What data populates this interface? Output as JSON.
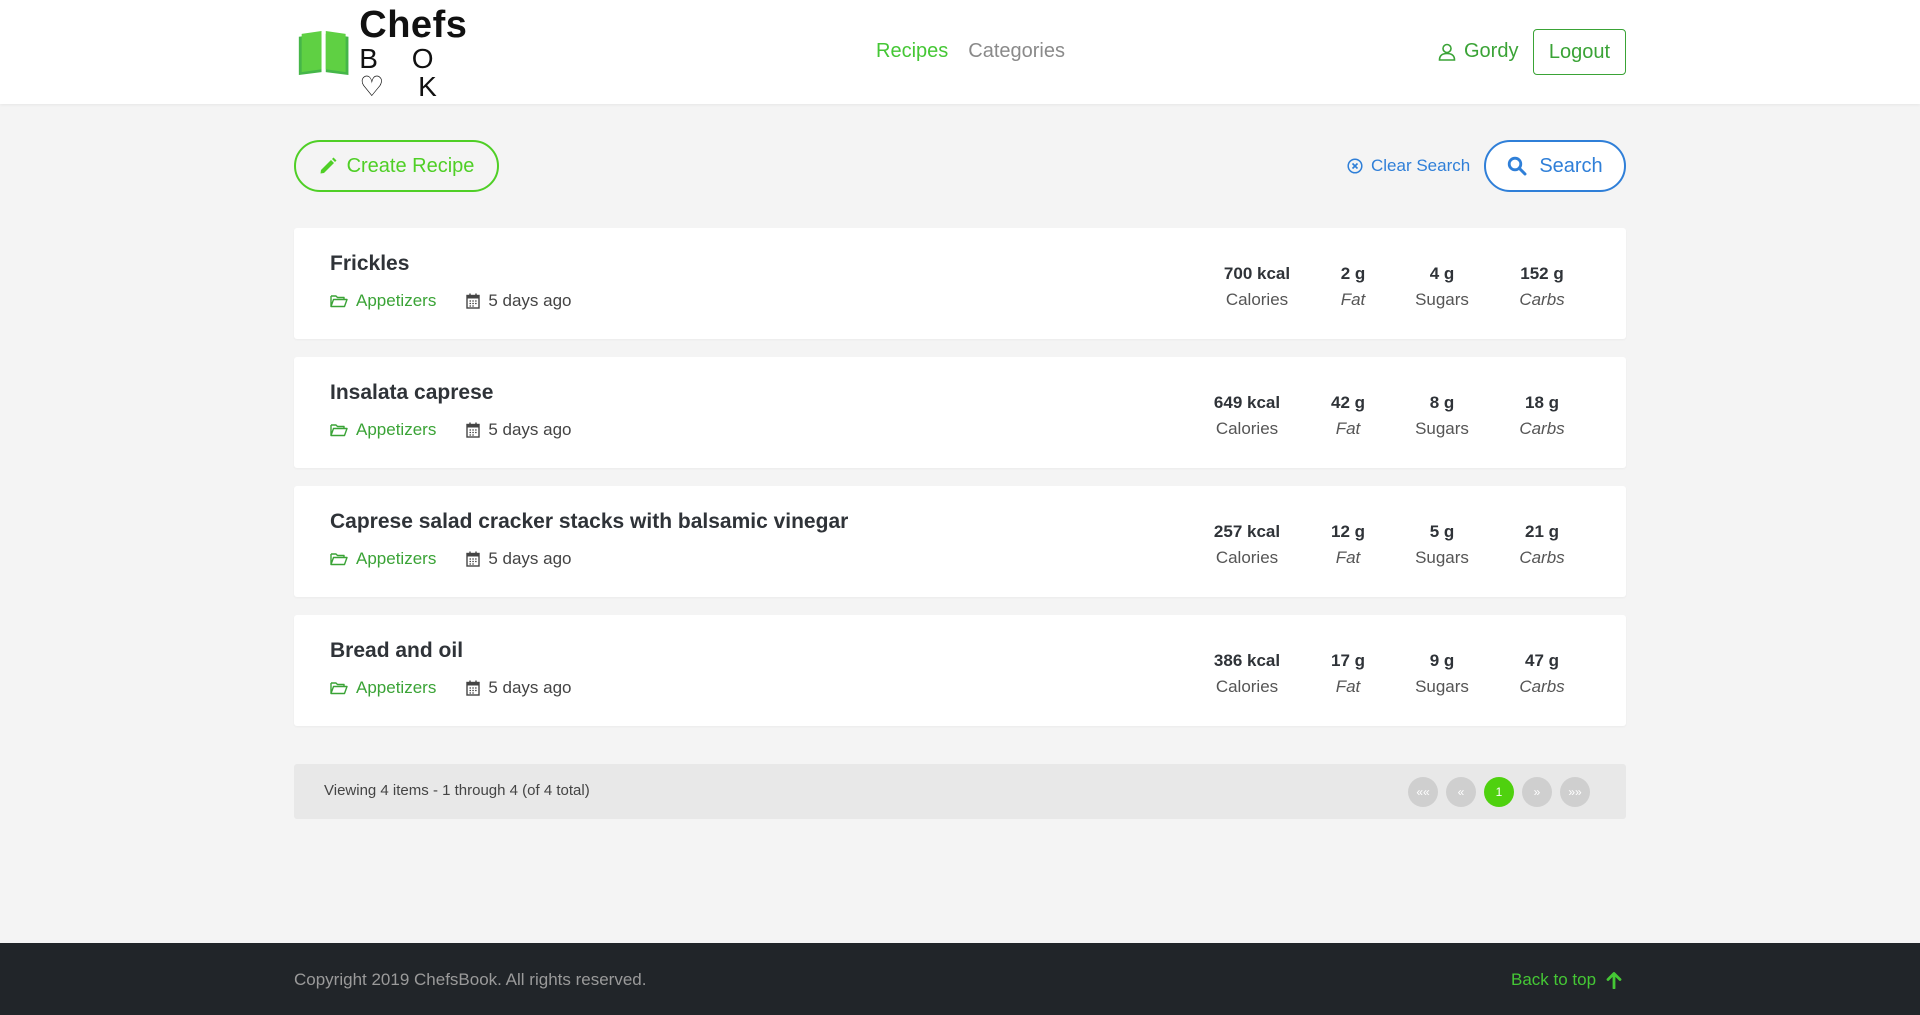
{
  "brand": {
    "line1": "Chefs",
    "line2": "B O ♡ K"
  },
  "nav": {
    "items": [
      "Recipes",
      "Categories"
    ]
  },
  "user": {
    "name": "Gordy",
    "logout": "Logout"
  },
  "toolbar": {
    "create_label": "Create Recipe",
    "clear_label": "Clear Search",
    "search_label": "Search"
  },
  "colors": {
    "accent": "#4fcf26",
    "link_blue": "#2f7fd8",
    "category_green": "#3aa336"
  },
  "recipes": [
    {
      "title": "Frickles",
      "category": "Appetizers",
      "date": "5 days ago",
      "calories": "700 kcal",
      "fat": "2 g",
      "sugars": "4 g",
      "carbs": "152 g"
    },
    {
      "title": "Insalata caprese",
      "category": "Appetizers",
      "date": "5 days ago",
      "calories": "649 kcal",
      "fat": "42 g",
      "sugars": "8 g",
      "carbs": "18 g"
    },
    {
      "title": "Caprese salad cracker stacks with balsamic vinegar",
      "category": "Appetizers",
      "date": "5 days ago",
      "calories": "257 kcal",
      "fat": "12 g",
      "sugars": "5 g",
      "carbs": "21 g"
    },
    {
      "title": "Bread and oil",
      "category": "Appetizers",
      "date": "5 days ago",
      "calories": "386 kcal",
      "fat": "17 g",
      "sugars": "9 g",
      "carbs": "47 g"
    }
  ],
  "stat_labels": {
    "calories": "Calories",
    "fat": "Fat",
    "sugars": "Sugars",
    "carbs": "Carbs"
  },
  "pagination": {
    "info": "Viewing 4 items - 1 through 4 (of 4 total)",
    "first": "««",
    "prev": "«",
    "page": "1",
    "next": "»",
    "last": "»»"
  },
  "footer": {
    "copyright": "Copyright 2019 ChefsBook. All rights reserved.",
    "back_to_top": "Back to top"
  }
}
